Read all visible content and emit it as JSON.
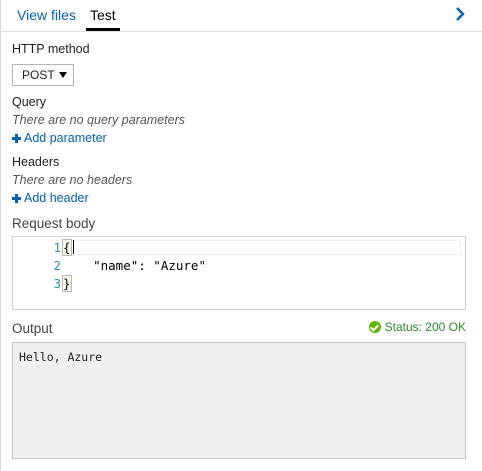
{
  "tabs": {
    "view_files": "View files",
    "test": "Test"
  },
  "http_method": {
    "label": "HTTP method",
    "selected": "POST"
  },
  "query": {
    "label": "Query",
    "empty_text": "There are no query parameters",
    "add_label": "Add parameter"
  },
  "headers": {
    "label": "Headers",
    "empty_text": "There are no headers",
    "add_label": "Add header"
  },
  "request_body": {
    "label": "Request body",
    "lines": [
      {
        "number": "1",
        "text": "{"
      },
      {
        "number": "2",
        "text": "    \"name\": \"Azure\""
      },
      {
        "number": "3",
        "text": "}"
      }
    ]
  },
  "output": {
    "label": "Output",
    "status": "Status: 200 OK",
    "text": "Hello, Azure"
  },
  "colors": {
    "link": "#0063b1",
    "status_ok": "#5db300",
    "line_number": "#2b91af"
  },
  "icons": {
    "collapse": "chevron-right-icon",
    "add": "plus-icon",
    "status": "checkmark-circle-icon",
    "dropdown": "caret-down-icon"
  }
}
